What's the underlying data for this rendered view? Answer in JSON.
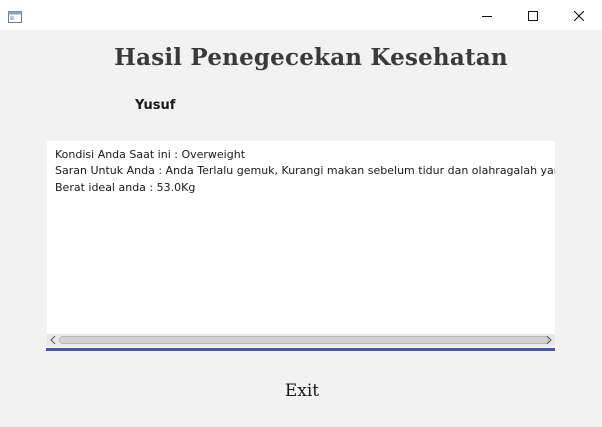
{
  "window": {
    "controls": {
      "minimize_icon": "minimize-icon",
      "maximize_icon": "maximize-icon",
      "close_icon": "close-icon"
    }
  },
  "header": {
    "title": "Hasil Penegecekan Kesehatan",
    "user_name": "Yusuf"
  },
  "result": {
    "lines": [
      "Kondisi Anda Saat ini : Overweight",
      "Saran Untuk Anda  : Anda Terlalu gemuk, Kurangi makan sebelum tidur dan olahragalah yang teratur",
      "Berat ideal anda : 53.0Kg"
    ]
  },
  "actions": {
    "exit_label": "Exit"
  },
  "colors": {
    "background": "#f2f2f2",
    "text_area": "#ffffff",
    "focus_accent": "#4a56a8"
  }
}
